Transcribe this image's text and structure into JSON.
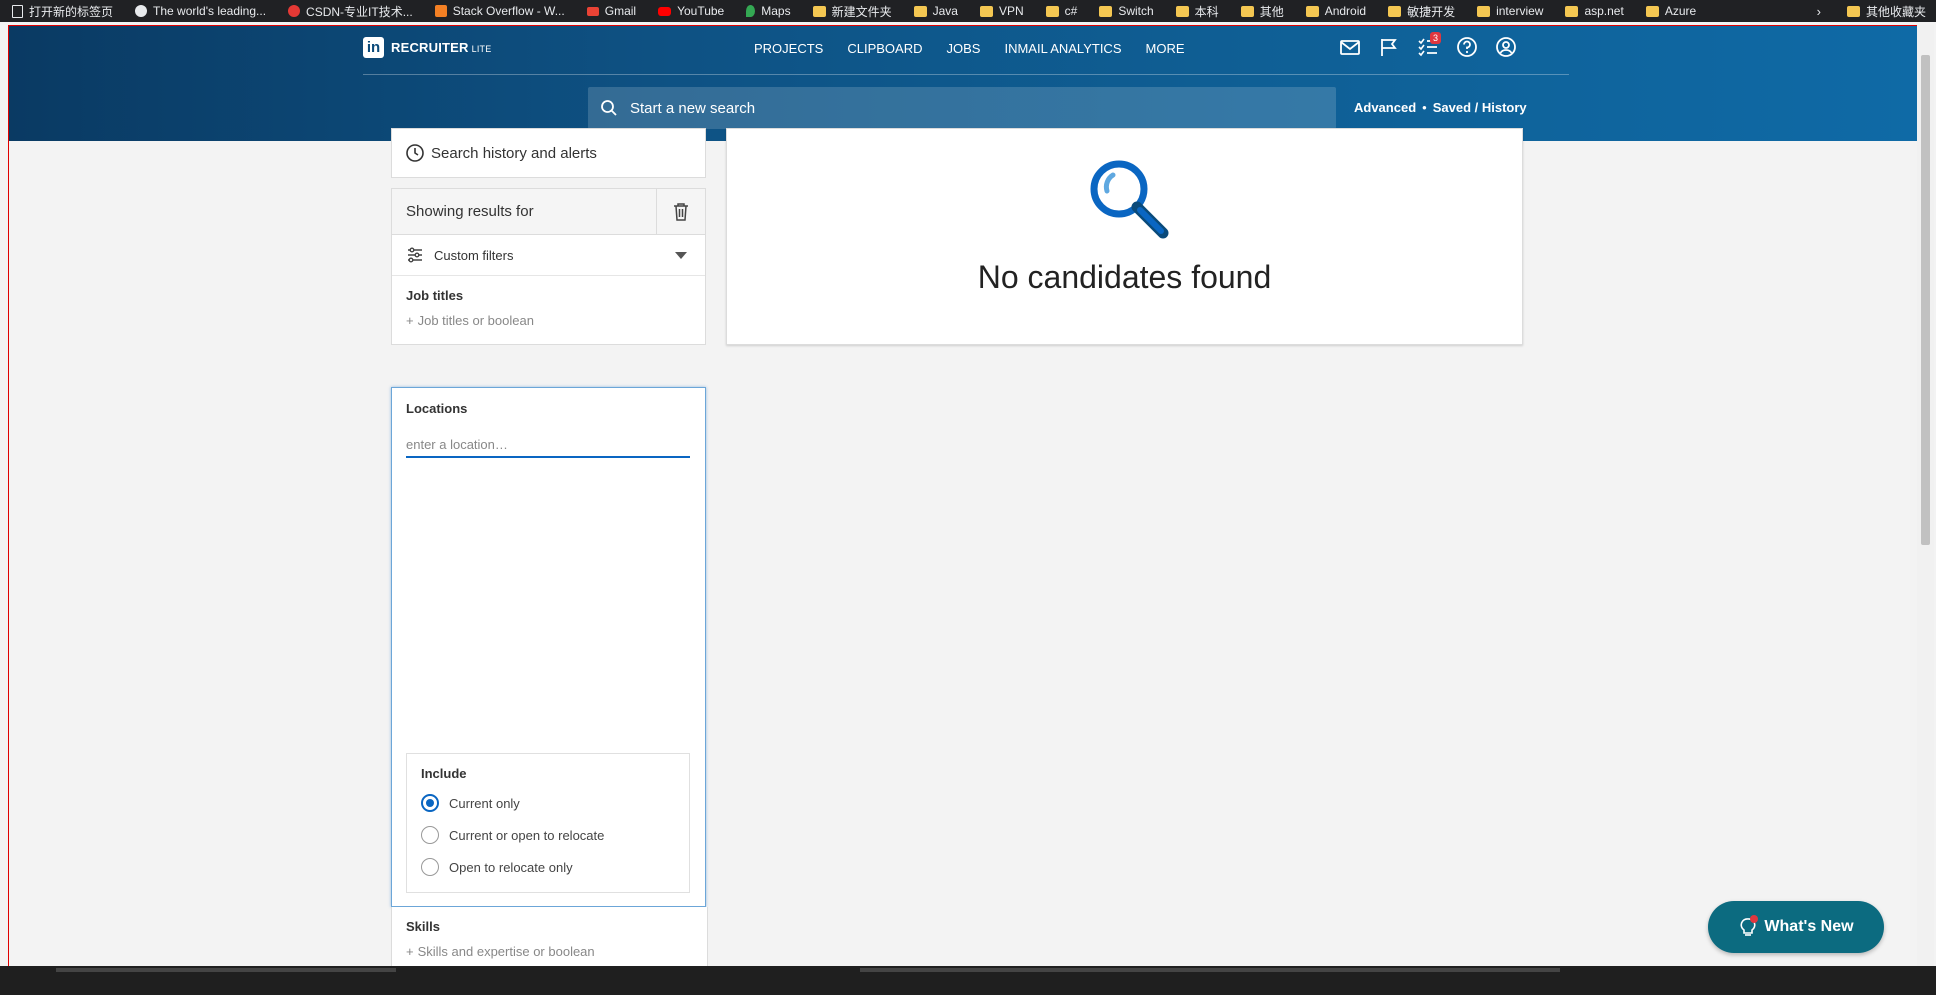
{
  "bookmarks": [
    {
      "label": "打开新的标签页",
      "icon": "page-icon"
    },
    {
      "label": "The world's leading...",
      "icon": "github-icon"
    },
    {
      "label": "CSDN-专业IT技术...",
      "icon": "csdn-icon"
    },
    {
      "label": "Stack Overflow - W...",
      "icon": "stackoverflow-icon"
    },
    {
      "label": "Gmail",
      "icon": "gmail-icon"
    },
    {
      "label": "YouTube",
      "icon": "youtube-icon"
    },
    {
      "label": "Maps",
      "icon": "maps-icon"
    },
    {
      "label": "新建文件夹",
      "icon": "folder-icon"
    },
    {
      "label": "Java",
      "icon": "folder-icon"
    },
    {
      "label": "VPN",
      "icon": "folder-icon"
    },
    {
      "label": "c#",
      "icon": "folder-icon"
    },
    {
      "label": "Switch",
      "icon": "folder-icon"
    },
    {
      "label": "本科",
      "icon": "folder-icon"
    },
    {
      "label": "其他",
      "icon": "folder-icon"
    },
    {
      "label": "Android",
      "icon": "folder-icon"
    },
    {
      "label": "敏捷开发",
      "icon": "folder-icon"
    },
    {
      "label": "interview",
      "icon": "folder-icon"
    },
    {
      "label": "asp.net",
      "icon": "folder-icon"
    },
    {
      "label": "Azure",
      "icon": "folder-icon"
    }
  ],
  "bookmarks_other": "其他收藏夹",
  "brand": {
    "name": "RECRUITER",
    "sub": "LITE",
    "logo_letter": "in"
  },
  "nav": [
    "PROJECTS",
    "CLIPBOARD",
    "JOBS",
    "INMAIL ANALYTICS",
    "MORE"
  ],
  "nav_icons": [
    "mail-icon",
    "flag-icon",
    "tasks-icon",
    "help-icon",
    "profile-icon"
  ],
  "tasks_badge": "3",
  "search": {
    "placeholder": "Start a new search"
  },
  "search_links": {
    "advanced": "Advanced",
    "separator": "•",
    "saved": "Saved / History"
  },
  "sidebar": {
    "history": "Search history and alerts",
    "showing": "Showing results for",
    "custom_filters": "Custom filters",
    "job_titles": {
      "title": "Job titles",
      "placeholder": "Job titles or boolean"
    },
    "locations": {
      "title": "Locations",
      "placeholder": "enter a location…"
    },
    "include": {
      "title": "Include",
      "options": [
        "Current only",
        "Current or open to relocate",
        "Open to relocate only"
      ],
      "selected": 0
    },
    "skills": {
      "title": "Skills",
      "placeholder": "Skills and expertise or boolean"
    }
  },
  "results": {
    "empty_title": "No candidates found"
  },
  "whats_new": "What's New",
  "colors": {
    "accent": "#0a66c2",
    "header": "#0e5284",
    "whats_new": "#0c6b80",
    "badge": "#e0373f"
  }
}
